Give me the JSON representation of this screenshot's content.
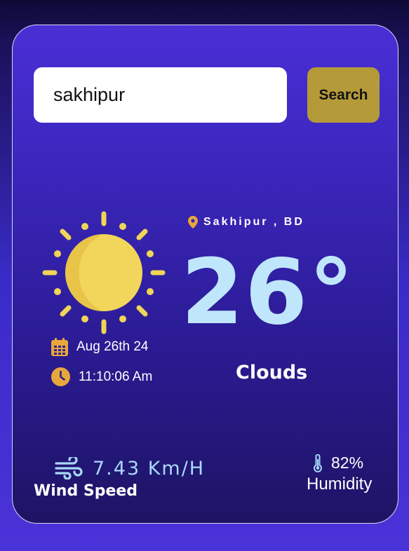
{
  "search": {
    "value": "sakhipur",
    "button_label": "Search"
  },
  "weather": {
    "location": "Sakhipur , BD",
    "temperature": "26°",
    "condition": "Clouds",
    "date": "Aug 26th 24",
    "time": "11:10:06 Am",
    "wind_speed": "7.43 Km/H",
    "wind_label": "Wind Speed",
    "humidity": "82%",
    "humidity_label": "Humidity"
  },
  "icons": {
    "condition": "sun-icon",
    "location": "map-pin-icon",
    "date": "calendar-icon",
    "time": "clock-icon",
    "wind": "wind-icon",
    "humidity": "thermometer-icon"
  },
  "colors": {
    "accent": "#e8a73a",
    "search_button": "#b59a39",
    "temperature": "#c0e6fb",
    "sun": "#f0d556"
  }
}
